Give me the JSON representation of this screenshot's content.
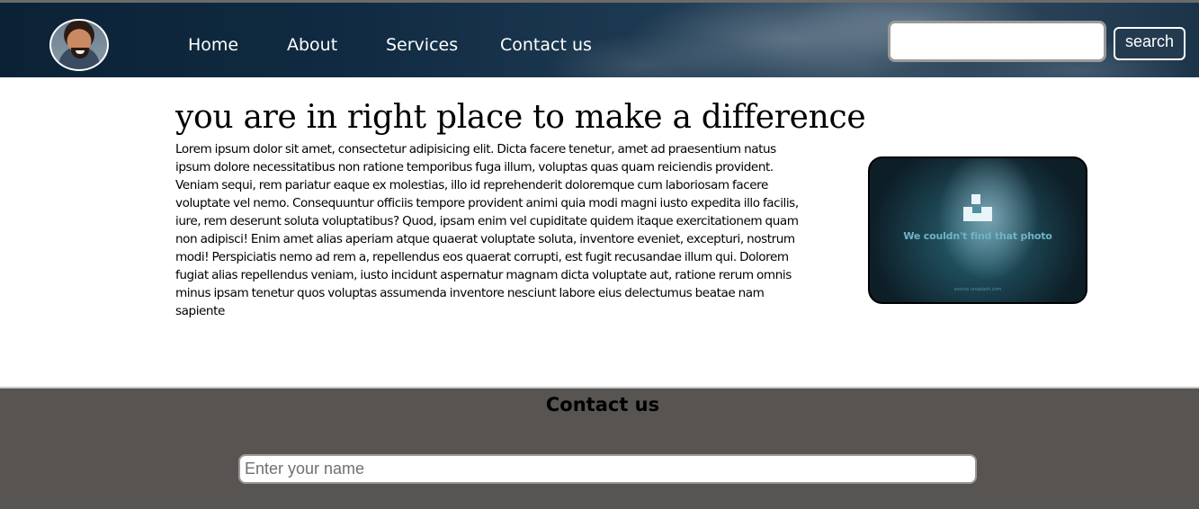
{
  "header": {
    "avatar_icon": "profile-photo-icon",
    "nav": {
      "home": "Home",
      "about": "About",
      "services": "Services",
      "contact": "Contact us"
    },
    "search": {
      "value": "",
      "placeholder": "",
      "button_label": "search"
    }
  },
  "main": {
    "heading": "you are in right place to make a difference",
    "paragraph": "Lorem ipsum dolor sit amet, consectetur adipisicing elit. Dicta facere tenetur, amet ad praesentium natus ipsum dolore necessitatibus non ratione temporibus fuga illum, voluptas quas quam reiciendis provident. Veniam sequi, rem pariatur eaque ex molestias, illo id reprehenderit doloremque cum laboriosam facere voluptate vel nemo. Consequuntur officiis tempore provident animi quia modi magni iusto expedita illo facilis, iure, rem deserunt soluta voluptatibus? Quod, ipsam enim vel cupiditate quidem itaque exercitationem quam non adipisci! Enim amet alias aperiam atque quaerat voluptate soluta, inventore eveniet, excepturi, nostrum modi! Perspiciatis nemo ad rem a, repellendus eos quaerat corrupti, est fugit recusandae illum qui. Dolorem fugiat alias repellendus veniam, iusto incidunt aspernatur magnam dicta voluptate aut, ratione rerum omnis minus ipsam tenetur quos voluptas assumenda inventore nesciunt labore eius delectumus beatae nam sapiente",
    "image": {
      "icon": "unsplash-logo-icon",
      "caption": "We couldn't find that photo",
      "footer": "source.unsplash.com"
    }
  },
  "contact": {
    "title": "Contact us",
    "name_placeholder": "Enter your name",
    "name_value": ""
  },
  "colors": {
    "header_dark": "#0b2236",
    "footer_bg": "#575451",
    "search_button_bg": "#243a4f",
    "photo_accent": "#6fb4c7"
  }
}
